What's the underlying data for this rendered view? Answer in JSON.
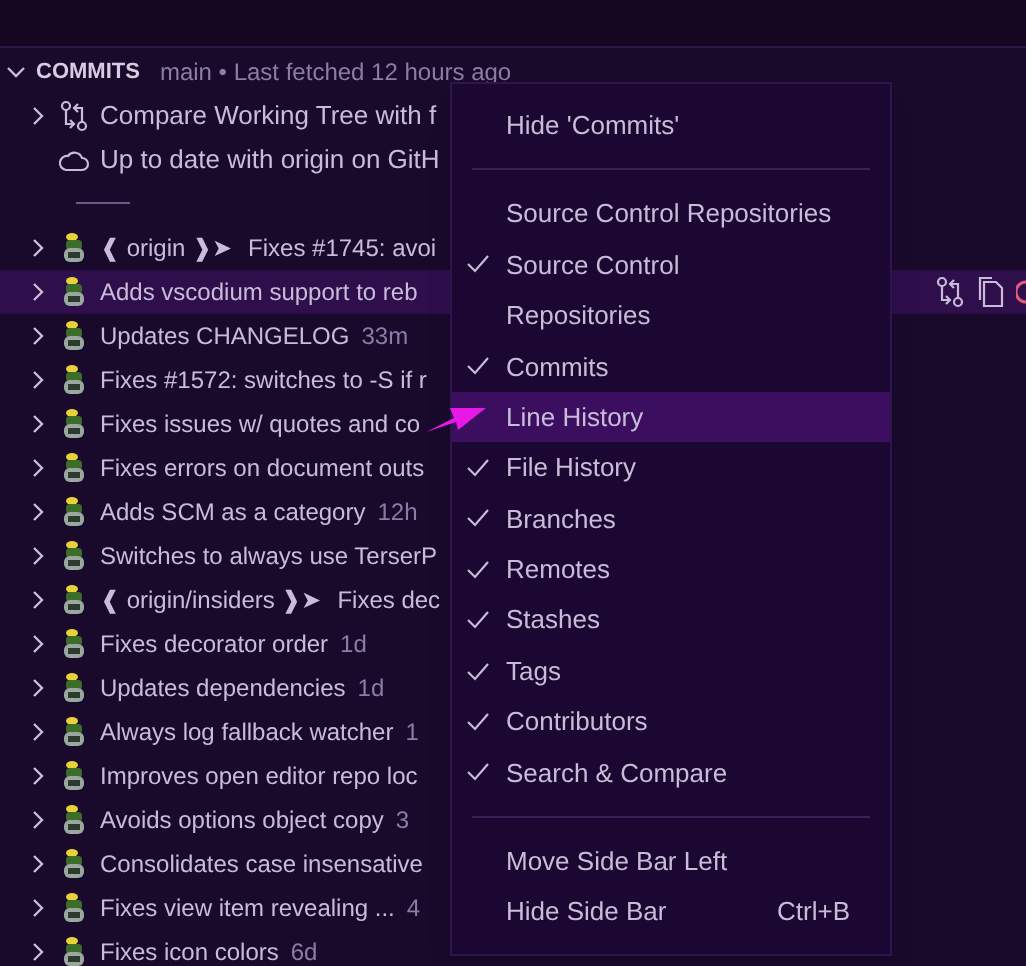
{
  "section": {
    "title": "COMMITS",
    "subtitle": "main • Last fetched 12 hours ago",
    "expanded": true
  },
  "top_rows": [
    {
      "kind": "compare",
      "label": "Compare Working Tree with f"
    },
    {
      "kind": "cloud",
      "label": "Up to date with origin on GitH"
    }
  ],
  "commits": [
    {
      "ref": "❰ origin ❱➤",
      "message": "Fixes #1745: avoi",
      "selected": false
    },
    {
      "message": "Adds vscodium support to reb",
      "selected": true
    },
    {
      "message": "Updates CHANGELOG",
      "time": "33m",
      "selected": false
    },
    {
      "message": "Fixes #1572: switches to -S if r",
      "selected": false
    },
    {
      "message": "Fixes issues w/ quotes and co",
      "selected": false
    },
    {
      "message": "Fixes errors on document outs",
      "selected": false
    },
    {
      "message": "Adds SCM as a category",
      "time": "12h",
      "selected": false
    },
    {
      "message": "Switches to always use TerserP",
      "selected": false
    },
    {
      "ref": "❰ origin/insiders ❱➤",
      "message": "Fixes dec",
      "selected": false
    },
    {
      "message": "Fixes decorator order",
      "time": "1d",
      "selected": false
    },
    {
      "message": "Updates dependencies",
      "time": "1d",
      "selected": false
    },
    {
      "message": "Always log fallback watcher",
      "time": "1",
      "selected": false
    },
    {
      "message": "Improves open editor repo loc",
      "selected": false
    },
    {
      "message": "Avoids options object copy",
      "time": "3",
      "selected": false
    },
    {
      "message": "Consolidates case insensative",
      "selected": false
    },
    {
      "message": "Fixes view item revealing ...",
      "time": "4",
      "selected": false
    },
    {
      "message": "Fixes icon colors",
      "time": "6d",
      "selected": false
    }
  ],
  "context_menu": [
    {
      "kind": "item",
      "label": "Hide 'Commits'",
      "checked": false,
      "selected": false
    },
    {
      "kind": "separator"
    },
    {
      "kind": "item",
      "label": "Source Control Repositories",
      "checked": false,
      "selected": false
    },
    {
      "kind": "item",
      "label": "Source Control",
      "checked": true,
      "selected": false
    },
    {
      "kind": "item",
      "label": "Repositories",
      "checked": false,
      "selected": false
    },
    {
      "kind": "item",
      "label": "Commits",
      "checked": true,
      "selected": false
    },
    {
      "kind": "item",
      "label": "Line History",
      "checked": false,
      "selected": true
    },
    {
      "kind": "item",
      "label": "File History",
      "checked": true,
      "selected": false
    },
    {
      "kind": "item",
      "label": "Branches",
      "checked": true,
      "selected": false
    },
    {
      "kind": "item",
      "label": "Remotes",
      "checked": true,
      "selected": false
    },
    {
      "kind": "item",
      "label": "Stashes",
      "checked": true,
      "selected": false
    },
    {
      "kind": "item",
      "label": "Tags",
      "checked": true,
      "selected": false
    },
    {
      "kind": "item",
      "label": "Contributors",
      "checked": true,
      "selected": false
    },
    {
      "kind": "item",
      "label": "Search & Compare",
      "checked": true,
      "selected": false
    },
    {
      "kind": "separator"
    },
    {
      "kind": "item",
      "label": "Move Side Bar Left",
      "checked": false,
      "selected": false
    },
    {
      "kind": "item",
      "label": "Hide Side Bar",
      "shortcut": "Ctrl+B",
      "checked": false,
      "selected": false
    }
  ]
}
